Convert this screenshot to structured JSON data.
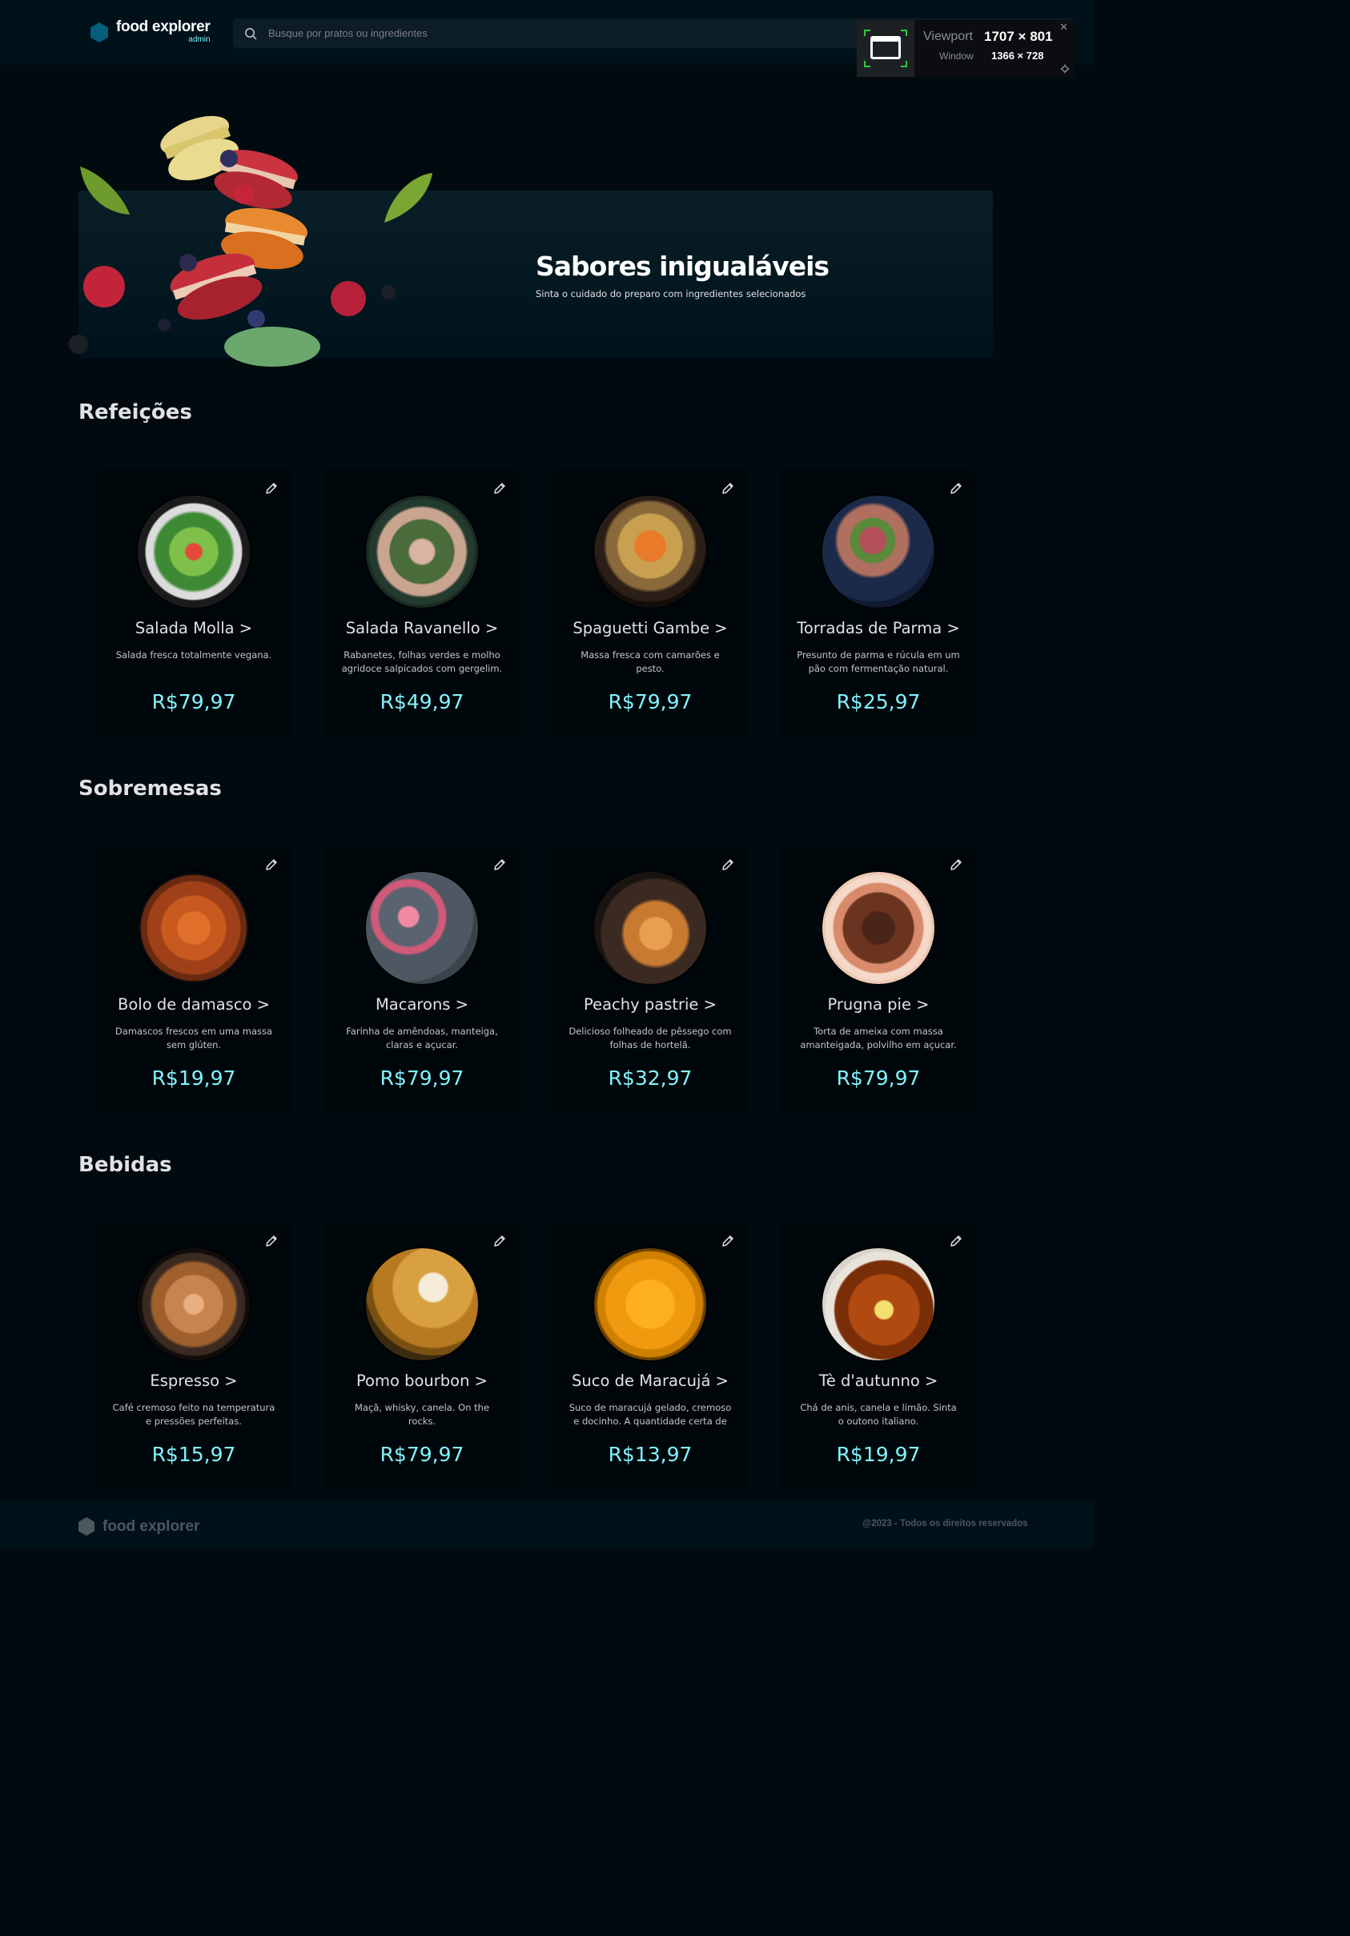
{
  "header": {
    "logo_name": "food explorer",
    "logo_role": "admin",
    "search_placeholder": "Busque por pratos ou ingredientes"
  },
  "viewport_overlay": {
    "viewport_label": "Viewport",
    "viewport_value": "1707 × 801",
    "window_label": "Window",
    "window_value": "1366 × 728"
  },
  "banner": {
    "title": "Sabores inigualáveis",
    "subtitle": "Sinta o cuidado do preparo com ingredientes selecionados"
  },
  "sections": [
    {
      "title": "Refeições",
      "items": [
        {
          "name": "Salada Molla >",
          "desc": "Salada fresca totalmente vegana.",
          "price": "R$79,97"
        },
        {
          "name": "Salada Ravanello >",
          "desc": "Rabanetes, folhas verdes e molho agridoce salpicados com gergelim.",
          "price": "R$49,97"
        },
        {
          "name": "Spaguetti Gambe >",
          "desc": "Massa fresca com camarões e pesto.",
          "price": "R$79,97"
        },
        {
          "name": "Torradas de Parma >",
          "desc": "Presunto de parma e rúcula em um pão com fermentação natural.",
          "price": "R$25,97"
        }
      ]
    },
    {
      "title": "Sobremesas",
      "items": [
        {
          "name": "Bolo de damasco >",
          "desc": "Damascos frescos em uma massa sem glúten.",
          "price": "R$19,97"
        },
        {
          "name": "Macarons >",
          "desc": "Farinha de amêndoas, manteiga, claras e açucar.",
          "price": "R$79,97"
        },
        {
          "name": "Peachy pastrie >",
          "desc": "Delicioso folheado de pêssego com folhas de hortelã.",
          "price": "R$32,97"
        },
        {
          "name": "Prugna pie >",
          "desc": "Torta de ameixa com massa amanteigada, polvilho em açucar.",
          "price": "R$79,97"
        }
      ]
    },
    {
      "title": "Bebidas",
      "items": [
        {
          "name": "Espresso >",
          "desc": "Café cremoso feito na temperatura e pressões perfeitas.",
          "price": "R$15,97"
        },
        {
          "name": "Pomo bourbon >",
          "desc": "Maçã, whisky, canela. On the rocks.",
          "price": "R$79,97"
        },
        {
          "name": "Suco de Maracujá >",
          "desc": "Suco de maracujá gelado, cremoso e docinho. A quantidade certa de",
          "price": "R$13,97"
        },
        {
          "name": "Tè d'autunno >",
          "desc": "Chá de anis, canela e limão. Sinta o outono italiano.",
          "price": "R$19,97"
        }
      ]
    }
  ],
  "footer": {
    "logo_name": "food explorer",
    "copyright": "@2023 - Todos os direitos reservados"
  },
  "colors": {
    "background": "#000a0f",
    "header": "#00111a",
    "accent": "#82f3ff",
    "logo": "#065e7c"
  }
}
